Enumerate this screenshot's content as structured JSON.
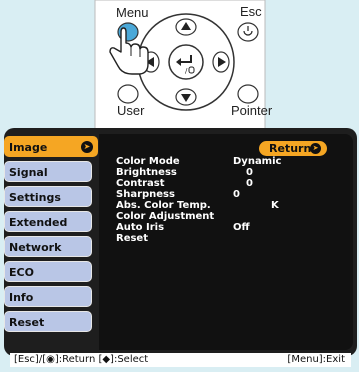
{
  "remote": {
    "menu_label": "Menu",
    "esc_label": "Esc",
    "user_label": "User",
    "pointer_label": "Pointer"
  },
  "sidebar": {
    "items": [
      {
        "label": "Image",
        "active": true
      },
      {
        "label": "Signal"
      },
      {
        "label": "Settings"
      },
      {
        "label": "Extended"
      },
      {
        "label": "Network"
      },
      {
        "label": "ECO"
      },
      {
        "label": "Info"
      },
      {
        "label": "Reset"
      }
    ]
  },
  "content": {
    "return_label": "Return",
    "rows": [
      {
        "label": "Color Mode",
        "value": "Dynamic"
      },
      {
        "label": "Brightness",
        "value": "0"
      },
      {
        "label": "Contrast",
        "value": "0"
      },
      {
        "label": "Sharpness",
        "value": "0"
      },
      {
        "label": "Abs. Color Temp.",
        "value": "K"
      },
      {
        "label": "Color Adjustment",
        "value": ""
      },
      {
        "label": "Auto Iris",
        "value": "Off"
      },
      {
        "label": "Reset",
        "value": ""
      }
    ]
  },
  "help": {
    "left": "[Esc]/[◉]:Return  [◆]:Select",
    "right": "[Menu]:Exit"
  },
  "colors": {
    "accent": "#f5a623",
    "sidebar_bg": "#b9c6e6",
    "panel_bg": "#111111",
    "frame_bg": "#d9eef3"
  }
}
